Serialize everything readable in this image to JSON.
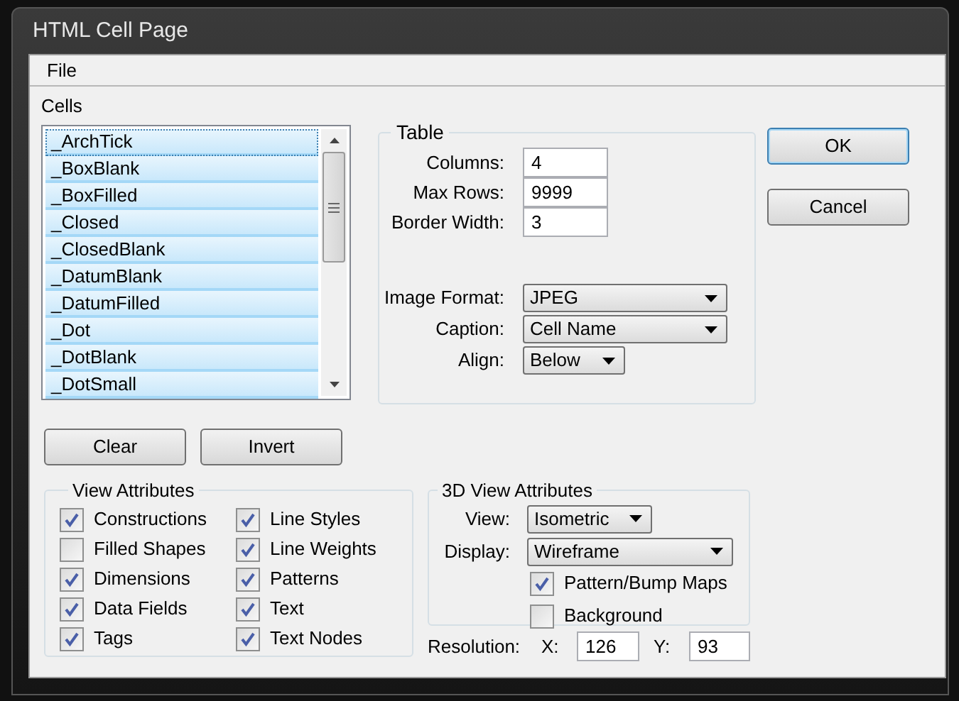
{
  "window": {
    "title": "HTML Cell Page"
  },
  "menu": [
    "File"
  ],
  "cells": {
    "label": "Cells",
    "items": [
      {
        "label": "_ArchTick",
        "selected": true,
        "focused": true
      },
      {
        "label": "_BoxBlank",
        "selected": true,
        "focused": false
      },
      {
        "label": "_BoxFilled",
        "selected": true,
        "focused": false
      },
      {
        "label": "_Closed",
        "selected": true,
        "focused": false
      },
      {
        "label": "_ClosedBlank",
        "selected": true,
        "focused": false
      },
      {
        "label": "_DatumBlank",
        "selected": true,
        "focused": false
      },
      {
        "label": "_DatumFilled",
        "selected": true,
        "focused": false
      },
      {
        "label": "_Dot",
        "selected": true,
        "focused": false
      },
      {
        "label": "_DotBlank",
        "selected": true,
        "focused": false
      },
      {
        "label": "_DotSmall",
        "selected": true,
        "focused": false
      }
    ]
  },
  "table": {
    "title": "Table",
    "fields": [
      {
        "label": "Columns:",
        "value": "4"
      },
      {
        "label": "Max Rows:",
        "value": "9999"
      },
      {
        "label": "Border Width:",
        "value": "3"
      }
    ],
    "dropdowns": [
      {
        "label": "Image Format:",
        "value": "JPEG"
      },
      {
        "label": "Caption:",
        "value": "Cell Name"
      },
      {
        "label": "Align:",
        "value": "Below"
      }
    ]
  },
  "dialog_buttons": [
    {
      "label": "OK",
      "default": true
    },
    {
      "label": "Cancel",
      "default": false
    }
  ],
  "list_buttons": [
    "Clear",
    "Invert"
  ],
  "view_attributes": {
    "title": "View Attributes",
    "items": [
      {
        "label": "Constructions",
        "checked": true
      },
      {
        "label": "Filled Shapes",
        "checked": false
      },
      {
        "label": "Dimensions",
        "checked": true
      },
      {
        "label": "Data Fields",
        "checked": true
      },
      {
        "label": "Tags",
        "checked": true
      },
      {
        "label": "Line Styles",
        "checked": true
      },
      {
        "label": "Line Weights",
        "checked": true
      },
      {
        "label": "Patterns",
        "checked": true
      },
      {
        "label": "Text",
        "checked": true
      },
      {
        "label": "Text Nodes",
        "checked": true
      }
    ]
  },
  "view_3d": {
    "title": "3D View Attributes",
    "dropdowns": [
      {
        "label": "View:",
        "value": "Isometric"
      },
      {
        "label": "Display:",
        "value": "Wireframe"
      }
    ],
    "checkboxes": [
      {
        "label": "Pattern/Bump Maps",
        "checked": true
      },
      {
        "label": "Background",
        "checked": false
      }
    ]
  },
  "resolution": {
    "label": "Resolution:",
    "x": {
      "label": "X:",
      "value": "126"
    },
    "y": {
      "label": "Y:",
      "value": "93"
    }
  }
}
